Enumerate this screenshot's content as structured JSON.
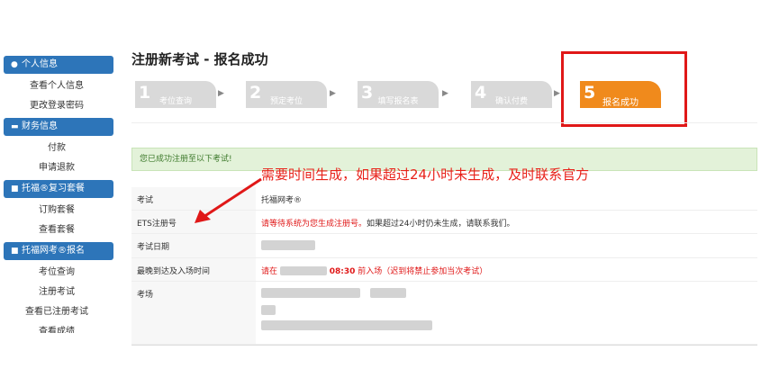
{
  "sidebar": {
    "sections": [
      {
        "icon": "user-icon",
        "title": "个人信息",
        "links": [
          "查看个人信息",
          "更改登录密码"
        ]
      },
      {
        "icon": "card-icon",
        "title": "财务信息",
        "links": [
          "付款",
          "申请退款"
        ]
      },
      {
        "icon": "book-icon",
        "title": "托福®复习套餐",
        "links": [
          "订购套餐",
          "查看套餐"
        ]
      },
      {
        "icon": "book-icon",
        "title": "托福网考®报名",
        "links": [
          "考位查询",
          "注册考试",
          "查看已注册考试",
          "查看成绩"
        ]
      }
    ]
  },
  "page": {
    "title": "注册新考试 - 报名成功"
  },
  "steps": [
    {
      "num": "1",
      "label": "考位查询"
    },
    {
      "num": "2",
      "label": "预定考位"
    },
    {
      "num": "3",
      "label": "填写报名表"
    },
    {
      "num": "4",
      "label": "确认付费"
    },
    {
      "num": "5",
      "label": "报名成功"
    }
  ],
  "success_message": "您已成功注册至以下考试!",
  "annotation": "需要时间生成，如果超过24小时未生成，及时联系官方",
  "table": {
    "exam_label": "考试",
    "exam_value": "托福网考®",
    "ets_label": "ETS注册号",
    "ets_red": "请等待系统为您生成注册号。",
    "ets_note": "如果超过24小时仍未生成，请联系我们。",
    "date_label": "考试日期",
    "arrival_label": "最晚到达及入场时间",
    "arrival_prefix": "请在",
    "arrival_time": "08:30",
    "arrival_suffix": "前入场（迟到将禁止参加当次考试）",
    "venue_label": "考场"
  },
  "colors": {
    "accent": "#2d75b9",
    "step_active": "#f08a1c",
    "annotation_red": "#e01818",
    "success_bg": "#e3f2d9"
  }
}
